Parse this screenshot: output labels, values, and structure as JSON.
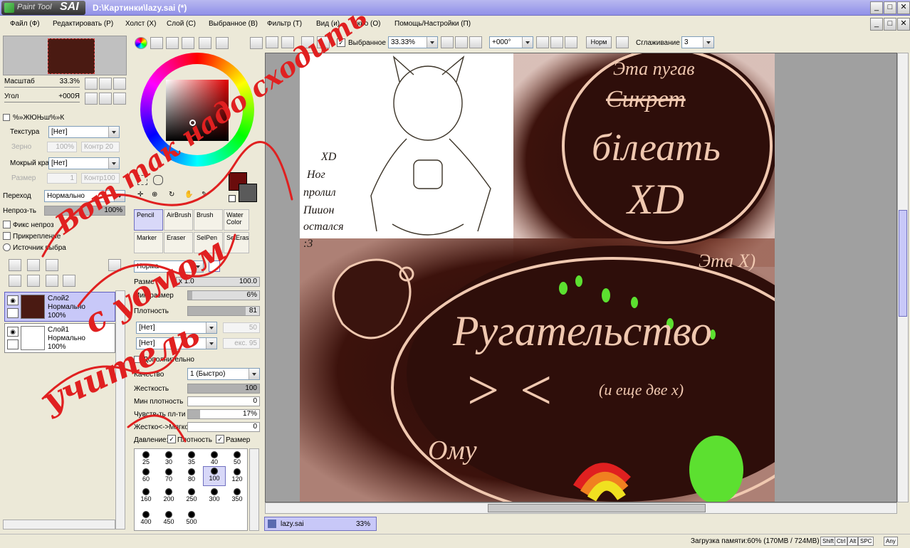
{
  "app": {
    "logo_small": "Paint Tool",
    "logo_big": "SAI",
    "window_title": "D:\\Картинки\\lazy.sai (*)"
  },
  "menu": [
    "Файл (Ф)",
    "Редактировать (Р)",
    "Холст (Х)",
    "Слой (С)",
    "Выбранное (В)",
    "Фильтр (Т)",
    "Вид (и)",
    "Окно (О)",
    "Помощь/Настройки (П)"
  ],
  "navigator": {
    "zoom_label": "Масштаб",
    "zoom_value": "33.3%",
    "angle_label": "Угол",
    "angle_value": "+000Я"
  },
  "paper": {
    "section_title": "%»ЖЮЊш%»К",
    "texture_label": "Текстура",
    "texture_value": "[Нет]",
    "grain_label": "Зерно",
    "grain_value": "100%",
    "contrast_label": "Контр",
    "contrast_value": "20",
    "wet_label": "Мокрый край",
    "wet_value": "[Нет]",
    "size_label": "Размер",
    "size_value": "1",
    "contrast2_label": "Контр100"
  },
  "blend": {
    "mode_label": "Переход",
    "mode_value": "Нормально",
    "opacity_label": "Непроз-ть",
    "opacity_value": "100%",
    "opacity_fraction": 1.0,
    "checks": [
      "Фикс непроз",
      "Прикрепление",
      "Источник выбра"
    ]
  },
  "layers": [
    {
      "name": "Слой2",
      "mode": "Нормально",
      "opacity": "100%",
      "selected": true
    },
    {
      "name": "Слой1",
      "mode": "Нормально",
      "opacity": "100%",
      "selected": false
    }
  ],
  "colors": {
    "primary": "#6a0c0c",
    "secondary": "#5a5a5a",
    "accent": "#c8c8f8"
  },
  "tools": [
    {
      "label": "Pencil",
      "selected": true
    },
    {
      "label": "AirBrush",
      "selected": false
    },
    {
      "label": "Brush",
      "selected": false
    },
    {
      "label": "Water Color",
      "selected": false
    },
    {
      "label": "Marker",
      "selected": false
    },
    {
      "label": "Eraser",
      "selected": false
    },
    {
      "label": "SelPen",
      "selected": false
    },
    {
      "label": "SelEras",
      "selected": false
    }
  ],
  "brush": {
    "mode_value": "Норма",
    "size_label": "Разме",
    "size_mult": "x 1.0",
    "size_value": "100.0",
    "minsize_label": "Мин размер",
    "minsize_value": "6%",
    "minsize_fraction": 0.06,
    "density_label": "Плотность",
    "density_value": "81",
    "density_fraction": 0.81,
    "shape_value": "[Нет]",
    "shape_num": "50",
    "texture_value": "[Нет]",
    "texture_label": "екс.",
    "texture_num": "95",
    "advanced_title": "Дополнительно",
    "quality_label": "Качество",
    "quality_value": "1 (Быстро)",
    "hardness_label": "Жесткость",
    "hardness_value": "100",
    "hardness_fraction": 1.0,
    "mindensity_label": "Мин плотность",
    "mindensity_value": "0",
    "sensitivity_label": "Чувств-ть пл-ти",
    "sensitivity_value": "17%",
    "sensitivity_fraction": 0.17,
    "hardsoft_label": "Жестко<->Мягко",
    "hardsoft_value": "0",
    "pressure_label": "Давление:",
    "pressure_density": "Плотность",
    "pressure_size": "Размер"
  },
  "brush_sizes": [
    "25",
    "30",
    "35",
    "40",
    "50",
    "60",
    "70",
    "80",
    "100",
    "120",
    "160",
    "200",
    "250",
    "300",
    "350",
    "400",
    "450",
    "500"
  ],
  "brush_selected": "100",
  "canvas_toolbar": {
    "selection_label": "Выбранное",
    "zoom": "33.33%",
    "angle": "+000°",
    "mode_button": "Норм",
    "smoothing_label": "Сглаживание",
    "smoothing_value": "3"
  },
  "tab": {
    "name": "lazy.sai",
    "zoom": "33%"
  },
  "status": {
    "memory": "Загрузка памяти:60% (170MB / 724MB)",
    "keys": [
      "Shift",
      "Ctrl",
      "Alt",
      "SPC",
      "Any"
    ]
  },
  "artwork": {
    "bubble_top_text": [
      "Эта пугав",
      "Сикрет",
      "бiлеать",
      "XD",
      "Эта Х)"
    ],
    "bubble_bottom_text": [
      "Ругательство",
      "(и еще две х)",
      "> <",
      "Ому"
    ],
    "left_notes": [
      "XD",
      "Ног",
      "пролил",
      "Пиион",
      "остался",
      ":3"
    ],
    "overlay_scribble": [
      "Вот так надо сходить",
      "с уомом",
      "учитель"
    ]
  }
}
